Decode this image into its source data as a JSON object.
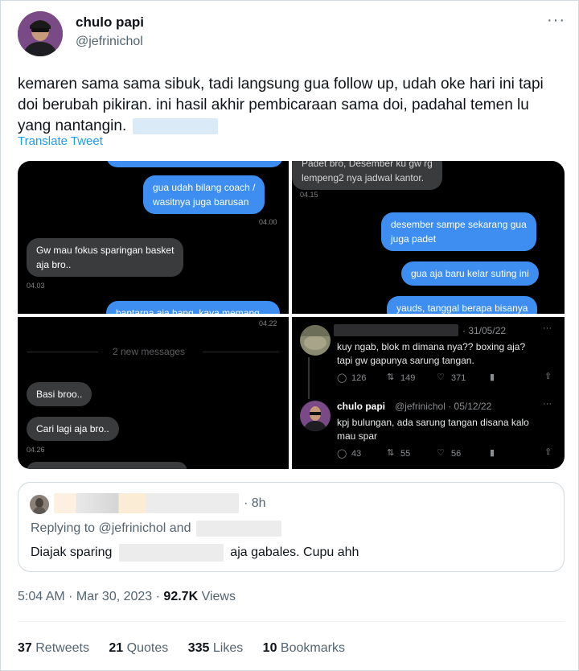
{
  "author": {
    "name": "chulo papi",
    "handle": "@jefrinichol"
  },
  "more_icon": "more-horizontal-icon",
  "tweet": {
    "text": "kemaren sama sama sibuk, tadi langsung gua follow up, udah oke hari ini tapi doi berubah pikiran. ini hasil akhir pembicaraan sama doi, padahal temen lu yang nantangin.",
    "translate_label": "Translate Tweet"
  },
  "media": {
    "panel1": {
      "out1": "gua udah bilang coach /\nwasitnya juga barusan",
      "ts1": "04.00",
      "in1": "Gw mau fokus sparingan basket\naja bro..",
      "ts2": "04.03",
      "out2_partial": "bantarna aja bang, kaya memang"
    },
    "panel2": {
      "in1_partial": "Padet bro, Desember ku gw rg\nlempeng2 nya jadwal kantor.",
      "ts1": "04.15",
      "out1": "desember sampe sekarang gua\njuga padet",
      "out2": "gua aja baru kelar suting ini",
      "out3": "yauds, tanggal berapa bisanya"
    },
    "panel3": {
      "ts_top": "04.22",
      "divider": "2 new messages",
      "in1": "Basi broo..",
      "in2": "Cari lagi aja bro..",
      "ts1": "04.26"
    },
    "panel4": {
      "t1": {
        "date": "· 31/05/22",
        "text": "kuy ngab, blok m dimana nya?? boxing aja?\ntapi gw gapunya sarung tangan.",
        "replies": "126",
        "retweets": "149",
        "likes": "371"
      },
      "t2": {
        "name": "chulo papi",
        "handle": "@jefrinichol · 05/12/22",
        "text": "kpj bulungan, ada sarung tangan disana kalo\nmau spar",
        "replies": "43",
        "retweets": "55",
        "likes": "56"
      }
    }
  },
  "quote": {
    "time": "· 8h",
    "replying_prefix": "Replying to",
    "replying_handle": "@jefrinichol",
    "replying_and": "and",
    "text_before": "Diajak sparing",
    "text_after": "aja gabales. Cupu ahh"
  },
  "meta": {
    "time": "5:04 AM · Mar 30, 2023 · ",
    "views_count": "92.7K",
    "views_label": "Views"
  },
  "stats": [
    {
      "count": "37",
      "label": "Retweets"
    },
    {
      "count": "21",
      "label": "Quotes"
    },
    {
      "count": "335",
      "label": "Likes"
    },
    {
      "count": "10",
      "label": "Bookmarks"
    }
  ]
}
